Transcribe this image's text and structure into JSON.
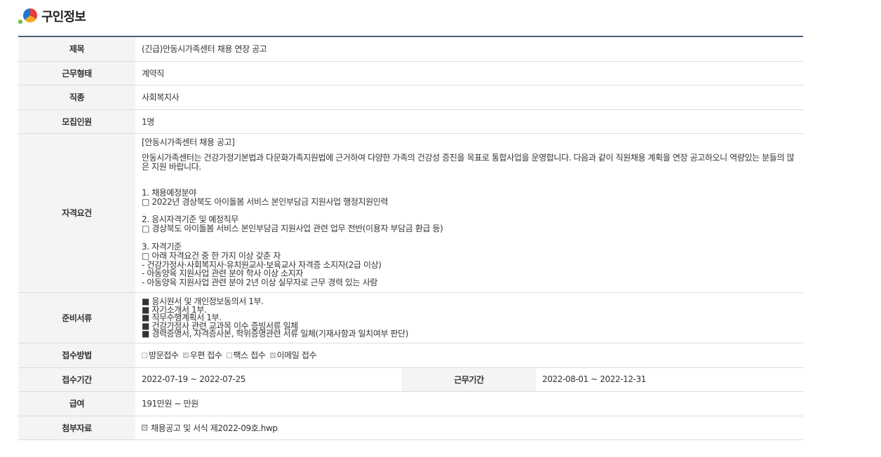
{
  "page_title": "구인정보",
  "table": {
    "title_label": "제목",
    "title_value": "(긴급)안동시가족센터 채용 연장 공고",
    "worktype_label": "근무형태",
    "worktype_value": "계약직",
    "jobtype_label": "직종",
    "jobtype_value": "사회복지사",
    "headcount_label": "모집인원",
    "headcount_value": "1명",
    "qualification_label": "자격요건",
    "qualification_lines": [
      "[안동시가족센터 채용 공고]",
      "안동시가족센터는 건강가정기본법과 다문화가족지원법에 근거하여 다양한 가족의 건강성 증진을 목표로 통합사업을 운영합니다. 다음과 같이 직원채용 계획을 연장 공고하오니 역량있는 분들의 많은 지원 바랍니다.",
      "1. 채용예정분야",
      "□ 2022년 경상북도 아이돌봄 서비스 본인부담금 지원사업 행정지원인력",
      "2. 응시자격기준 및 예정직무",
      "□ 경상북도 아이돌봄 서비스 본인부담금 지원사업 관련 업무 전반(이용자 부담금 환급 등)",
      "3. 자격기준",
      "□ 아래 자격요건 중 한 가지 이상 갖춘 자",
      " - 건강가정사·사회복지사·유치원교사·보육교사 자격증 소지자(2급 이상)",
      " - 아동양육 지원사업 관련 분야 학사 이상 소지자",
      " - 아동양육 지원사업 관련 분야 2년 이상 실무자로 근무 경력 있는 사람"
    ],
    "documents_label": "준비서류",
    "documents_lines": [
      "■ 응시원서 및 개인정보동의서 1부.",
      "■ 자기소개서 1부.",
      "■ 직무수행계획서 1부.",
      "■ 건강가정사 관련 교과목 이수 증빙서류 일체",
      "■ 경력증명서, 자격증사본, 학위증명관련 서류 일체(기재사항과 일치여부 판단)"
    ],
    "method_label": "접수방법",
    "methods": [
      {
        "label": "방문접수",
        "checked": false
      },
      {
        "label": "우편 접수",
        "checked": true
      },
      {
        "label": "팩스 접수",
        "checked": false
      },
      {
        "label": "이메일 접수",
        "checked": true
      }
    ],
    "period_label": "접수기간",
    "period_value": "2022-07-19 ~ 2022-07-25",
    "workperiod_label": "근무기간",
    "workperiod_value": "2022-08-01 ~ 2022-12-31",
    "salary_label": "급여",
    "salary_value": "191만원 ~ 만원",
    "attachment_label": "첨부자료",
    "attachment_file": "채용공고 및 서식 제2022-09호.hwp"
  }
}
